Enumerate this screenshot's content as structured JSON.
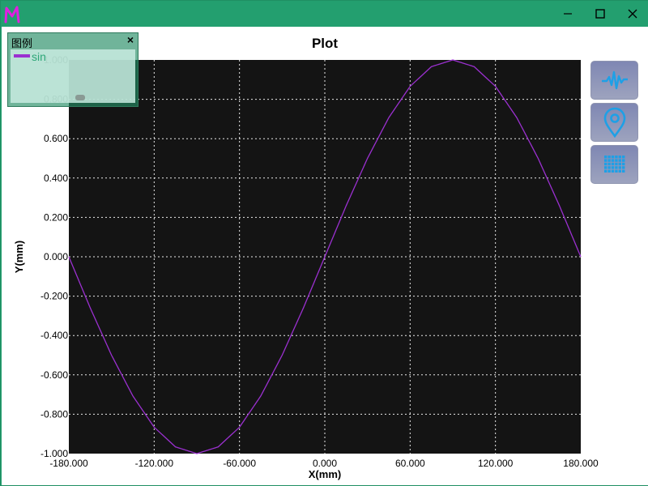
{
  "window": {
    "logo_letter": "M",
    "controls": {
      "minimize": "minimize-icon",
      "maximize": "maximize-icon",
      "close": "close-icon"
    }
  },
  "legend": {
    "title": "图例",
    "close_glyph": "×",
    "items": [
      {
        "label": "sin",
        "color": "#9b30d0"
      }
    ]
  },
  "toolbar": {
    "buttons": [
      {
        "name": "waveform-button",
        "icon": "waveform-icon"
      },
      {
        "name": "location-pin-button",
        "icon": "location-pin-icon"
      },
      {
        "name": "grid-table-button",
        "icon": "grid-table-icon"
      }
    ],
    "icon_color": "#1ea0e6"
  },
  "chart_data": {
    "type": "line",
    "title": "Plot",
    "xlabel": "X(mm)",
    "ylabel": "Y(mm)",
    "xlim": [
      -180,
      180
    ],
    "ylim": [
      -1.0,
      1.0
    ],
    "x_ticks": [
      -180,
      -120,
      -60,
      0,
      60,
      120,
      180
    ],
    "x_tick_labels": [
      "-180.000",
      "-120.000",
      "-60.000",
      "0.000",
      "60.000",
      "120.000",
      "180.000"
    ],
    "y_ticks": [
      -1.0,
      -0.8,
      -0.6,
      -0.4,
      -0.2,
      0.0,
      0.2,
      0.4,
      0.6,
      0.8,
      1.0
    ],
    "y_tick_labels": [
      "-1.000",
      "-0.800",
      "-0.600",
      "-0.400",
      "-0.200",
      "0.000",
      "0.200",
      "0.400",
      "0.600",
      "0.800",
      "1.000"
    ],
    "grid": true,
    "background": "#141414",
    "grid_color": "#ffffff",
    "series": [
      {
        "name": "sin",
        "color": "#9b30d0",
        "x": [
          -180,
          -165,
          -150,
          -135,
          -120,
          -105,
          -90,
          -75,
          -60,
          -45,
          -30,
          -15,
          0,
          15,
          30,
          45,
          60,
          75,
          90,
          105,
          120,
          135,
          150,
          165,
          180
        ],
        "y": [
          0,
          -0.259,
          -0.5,
          -0.707,
          -0.866,
          -0.966,
          -1,
          -0.966,
          -0.866,
          -0.707,
          -0.5,
          -0.259,
          0,
          0.259,
          0.5,
          0.707,
          0.866,
          0.966,
          1,
          0.966,
          0.866,
          0.707,
          0.5,
          0.259,
          0
        ]
      }
    ]
  }
}
